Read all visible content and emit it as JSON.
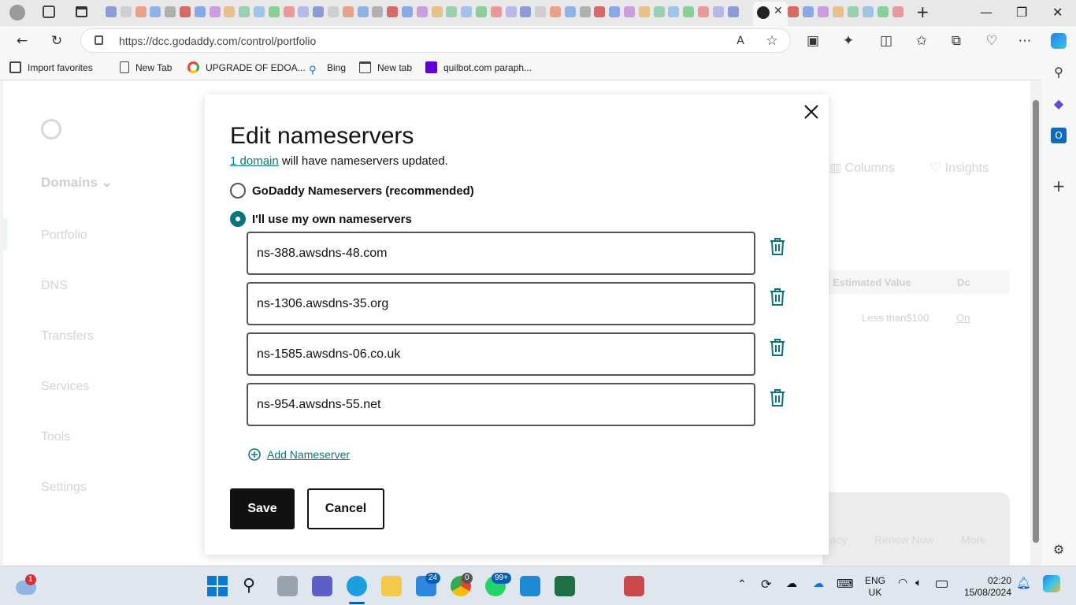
{
  "browser": {
    "url": "https://dcc.godaddy.com/control/portfolio",
    "favorites": [
      {
        "label": "Import favorites"
      },
      {
        "label": "New Tab"
      },
      {
        "label": "UPGRADE OF EDOA..."
      },
      {
        "label": "Bing"
      },
      {
        "label": "New tab"
      },
      {
        "label": "quilbot.com paraph..."
      }
    ]
  },
  "background": {
    "sidebar": {
      "domains_label": "Domains",
      "items": [
        "Portfolio",
        "DNS",
        "Transfers",
        "Services",
        "Tools",
        "Settings"
      ]
    },
    "toolbar": {
      "columns": "Columns",
      "insights": "Insights"
    },
    "table": {
      "estimated_value_header": "Estimated Value",
      "dc_header": "Dc",
      "value": "Less than$100",
      "on": "On"
    },
    "actions": {
      "renew_now": "Renew Now",
      "more": "More",
      "privacy_fragment": "acy"
    }
  },
  "modal": {
    "title": "Edit nameservers",
    "subtitle_link": "1 domain",
    "subtitle_rest": " will have nameservers updated.",
    "option_godaddy": "GoDaddy Nameservers (recommended)",
    "option_own": "I'll use my own nameservers",
    "selected_option": "own",
    "nameservers": [
      "ns-388.awsdns-48.com",
      "ns-1306.awsdns-35.org",
      "ns-1585.awsdns-06.co.uk",
      "ns-954.awsdns-55.net"
    ],
    "add_label": "Add Nameserver",
    "save_label": "Save",
    "cancel_label": "Cancel"
  },
  "taskbar": {
    "weather_badge": "1",
    "mail_badge": "24",
    "chrome_badge": "0",
    "whatsapp_badge": "99+",
    "language": "ENG",
    "region": "UK",
    "time": "02:20",
    "date": "15/08/2024"
  },
  "colors": {
    "accent": "#09757a",
    "button_dark": "#111111"
  }
}
